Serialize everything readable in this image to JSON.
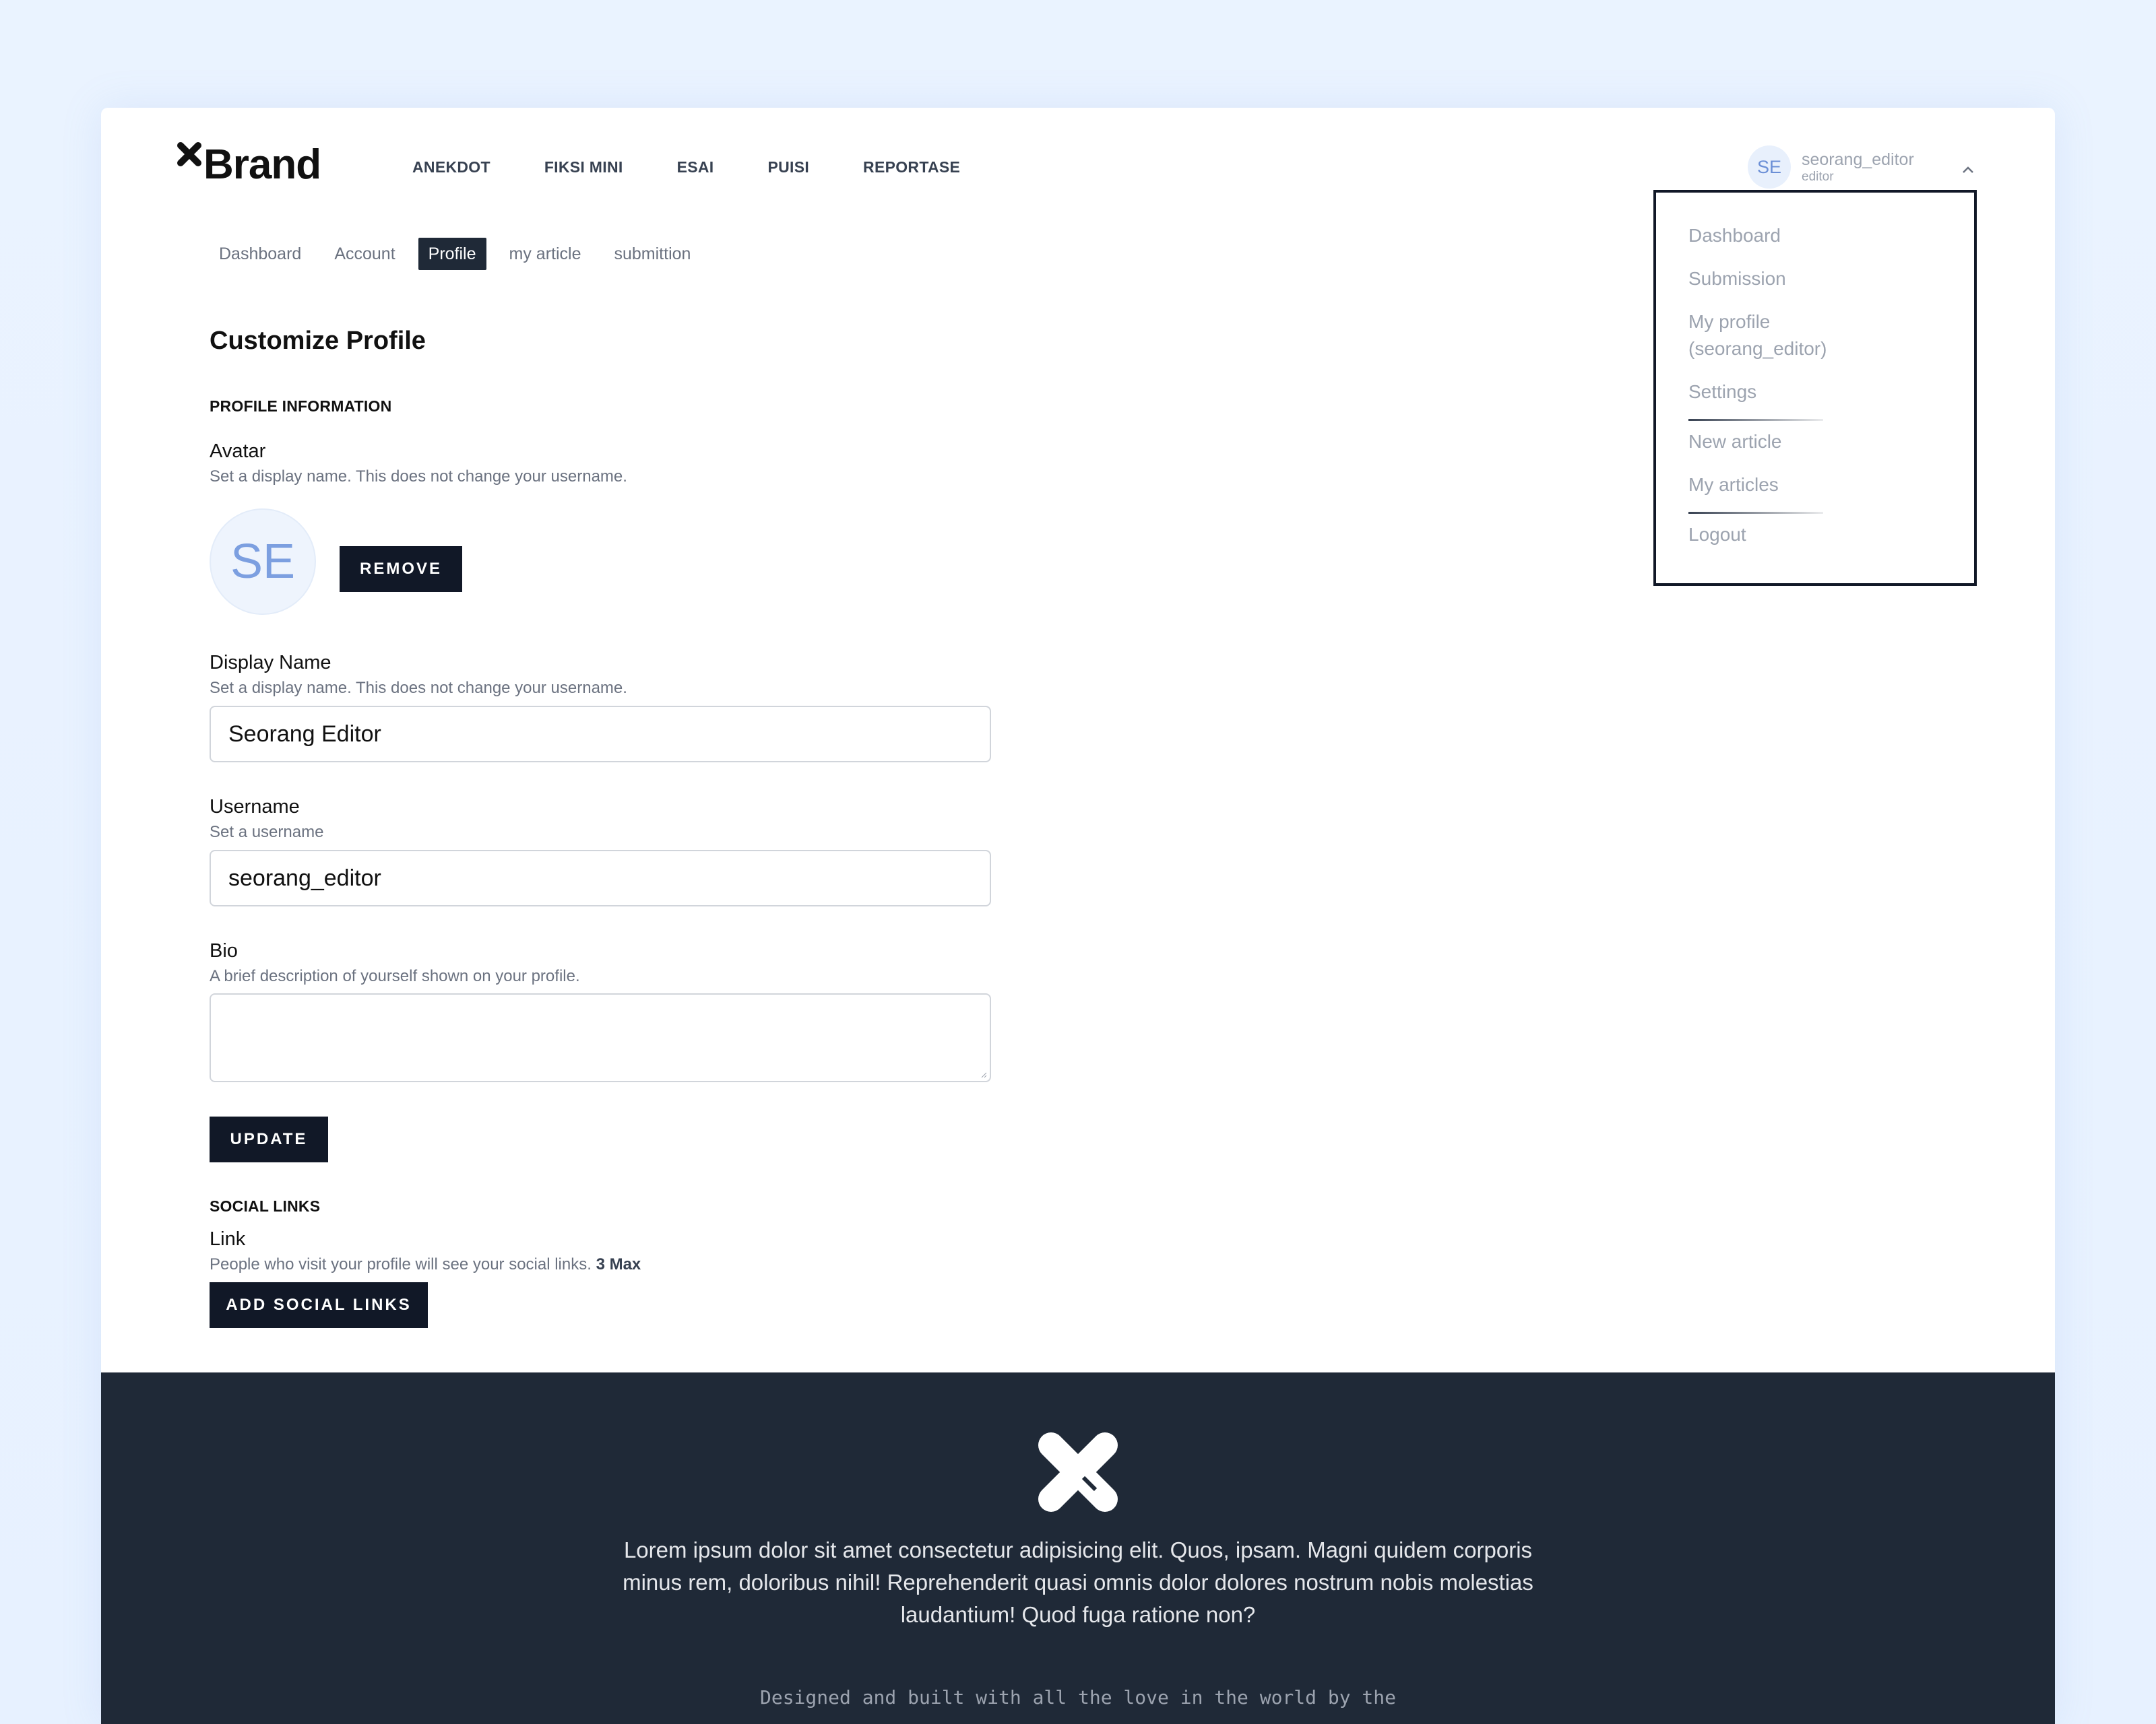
{
  "header": {
    "brand": "Brand",
    "nav": [
      "ANEKDOT",
      "FIKSI MINI",
      "ESAI",
      "PUISI",
      "REPORTASE"
    ],
    "user": {
      "initials": "SE",
      "name": "seorang_editor",
      "role": "editor"
    }
  },
  "dropdown": {
    "items": [
      "Dashboard",
      "Submission",
      "My profile (seorang_editor)",
      "Settings",
      "New article",
      "My articles",
      "Logout"
    ]
  },
  "tabs": [
    "Dashboard",
    "Account",
    "Profile",
    "my article",
    "submittion"
  ],
  "active_tab": "Profile",
  "main": {
    "title": "Customize Profile",
    "profile_section": "PROFILE INFORMATION",
    "avatar": {
      "label": "Avatar",
      "help": "Set a display name. This does not change your username.",
      "initials": "SE",
      "remove_label": "REMOVE"
    },
    "display_name": {
      "label": "Display Name",
      "help": "Set a display name. This does not change your username.",
      "value": "Seorang Editor"
    },
    "username": {
      "label": "Username",
      "help": "Set a username",
      "value": "seorang_editor"
    },
    "bio": {
      "label": "Bio",
      "help": "A brief description of yourself shown on your profile.",
      "value": ""
    },
    "update_label": "UPDATE",
    "social_section": "SOCIAL LINKS",
    "link": {
      "label": "Link",
      "help": "People who visit your profile will see your social links.",
      "max": "3 Max"
    },
    "add_social_label": "ADD SOCIAL LINKS"
  },
  "footer": {
    "text": "Lorem ipsum dolor sit amet consectetur adipisicing elit. Quos, ipsam. Magni quidem corporis minus rem, doloribus nihil! Reprehenderit quasi omnis dolor dolores nostrum nobis molestias laudantium! Quod fuga ratione non?",
    "credit": "Designed and built with all the love in the world by the"
  },
  "colors": {
    "dark": "#111827",
    "footer_bg": "#1f2937",
    "page_bg": "#e7f1ff",
    "muted": "#9ca3af"
  }
}
